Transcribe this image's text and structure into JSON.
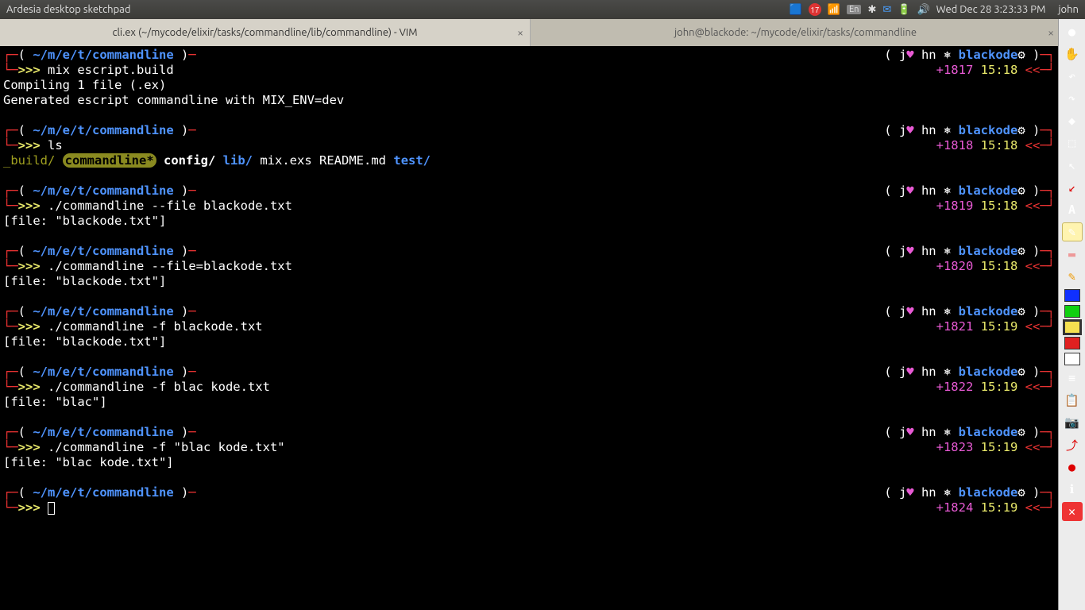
{
  "menubar": {
    "app_title": "Ardesia desktop sketchpad",
    "notifications": "17",
    "lang": "En",
    "clock": "Wed Dec 28 3:23:33 PM",
    "user": "john"
  },
  "tabs": {
    "left": "cli.ex (~/mycode/elixir/tasks/commandline/lib/commandline) - VIM",
    "right": "john@blackode: ~/mycode/elixir/tasks/commandline",
    "close": "×",
    "plus": "+"
  },
  "prompt": {
    "path": "~/m/e/t/commandline",
    "left_open": "┌─(",
    "left_close": ")",
    "right_open": "(",
    "right_close": ")─┐",
    "arrow_left": "└─",
    "chevrons": ">>>",
    "tail_arrow": "<<─┘",
    "user_j": "j",
    "heart": "♥",
    "user_hn": "hn",
    "host": "blackode",
    "gear": "⚙"
  },
  "blocks": [
    {
      "cmd": "mix escript.build",
      "out": [
        "Compiling 1 file (.ex)",
        "Generated escript commandline with MIX_ENV=dev"
      ],
      "hist": "+1817",
      "time": "15:18"
    },
    {
      "cmd": "ls",
      "ls": true,
      "hist": "+1818",
      "time": "15:18"
    },
    {
      "cmd": "./commandline --file blackode.txt",
      "out": [
        "[file: \"blackode.txt\"]"
      ],
      "hist": "+1819",
      "time": "15:18"
    },
    {
      "cmd": "./commandline --file=blackode.txt",
      "out": [
        "[file: \"blackode.txt\"]"
      ],
      "hist": "+1820",
      "time": "15:18"
    },
    {
      "cmd": "./commandline -f blackode.txt",
      "out": [
        "[file: \"blackode.txt\"]"
      ],
      "hist": "+1821",
      "time": "15:19"
    },
    {
      "cmd": "./commandline -f blac kode.txt",
      "out": [
        "[file: \"blac\"]"
      ],
      "hist": "+1822",
      "time": "15:19"
    },
    {
      "cmd": "./commandline -f \"blac kode.txt\"",
      "out": [
        "[file: \"blac kode.txt\"]"
      ],
      "hist": "+1823",
      "time": "15:19"
    },
    {
      "cmd": "",
      "out": [],
      "hist": "+1824",
      "time": "15:19",
      "cursor": true
    }
  ],
  "ls": {
    "build": "_build/",
    "cmdline": "commandline*",
    "config": "config/",
    "lib": "lib/",
    "mixexs": "mix.exs",
    "readme": "README.md",
    "test": "test/"
  },
  "tools": [
    "●",
    "✋",
    "↶",
    "↷",
    "◆",
    "⬚",
    "⬅",
    "✎",
    "A"
  ],
  "swatches": [
    "#1030ff",
    "#10d010",
    "#f5e050",
    "#e02020",
    "#ffffff"
  ]
}
